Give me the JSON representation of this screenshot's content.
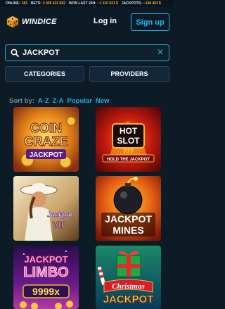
{
  "ticker": [
    {
      "label": "ONLINE:",
      "value": "183"
    },
    {
      "label": "BETS:",
      "value": "2 435 422 652"
    },
    {
      "label": "WON LAST 24H:",
      "value": "~1 115 621 $"
    },
    {
      "label": "JACKPOTS:",
      "value": "~168 453 $"
    }
  ],
  "header": {
    "brand": "WINDICE",
    "login_label": "Log in",
    "signup_label": "Sign up"
  },
  "search": {
    "value": "JACKPOT",
    "clear_icon": "close-icon"
  },
  "filters": {
    "categories_label": "CATEGORIES",
    "providers_label": "PROVIDERS"
  },
  "sort": {
    "label": "Sort by:",
    "options": [
      "A-Z",
      "Z-A",
      "Popular",
      "New"
    ],
    "active": "Popular"
  },
  "games": [
    {
      "title_lines": [
        "COIN",
        "CRAZE",
        "JACKPOT"
      ]
    },
    {
      "title_lines": [
        "HOT",
        "SLOT",
        "777",
        "HOLD THE JACKPOT"
      ]
    },
    {
      "title_lines": [
        "Jackpot",
        "VIP"
      ]
    },
    {
      "title_lines": [
        "JACKPOT",
        "MINES"
      ]
    },
    {
      "title_lines": [
        "JACKPOT",
        "LIMBO",
        "9999x"
      ]
    },
    {
      "title_lines": [
        "Christmas",
        "JACKPOT"
      ]
    }
  ],
  "colors": {
    "background": "#0d1b26",
    "accent": "#2aa7d6",
    "gold": "#f2b43a"
  }
}
